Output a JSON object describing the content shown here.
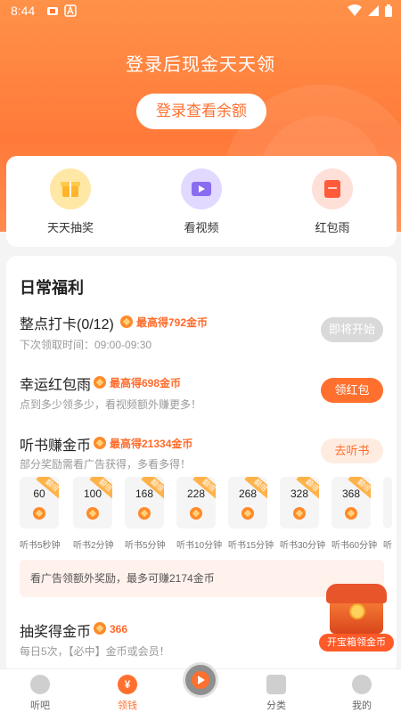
{
  "status_bar": {
    "time": "8:44"
  },
  "hero": {
    "title": "登录后现金天天领",
    "login_button": "登录查看余额"
  },
  "features": [
    {
      "label": "天天抽奖",
      "icon": "gift-icon",
      "color": "#ffe7a6"
    },
    {
      "label": "看视频",
      "icon": "tv-icon",
      "color": "#e1d9ff"
    },
    {
      "label": "红包雨",
      "icon": "red-envelope-icon",
      "color": "#ffe0d9"
    }
  ],
  "welfare": {
    "title": "日常福利",
    "tasks": [
      {
        "title": "整点打卡(0/12)",
        "reward": "最高得792金币",
        "sub": "下次领取时间：09:00-09:30",
        "button": "即将开始"
      },
      {
        "title": "幸运红包雨",
        "reward": "最高得698金币",
        "sub": "点到多少领多少，看视频额外赚更多！",
        "button": "领红包"
      },
      {
        "title": "听书赚金币",
        "reward": "最高得21334金币",
        "sub": "部分奖励需看广告获得，多看多得！",
        "button": "去听书"
      }
    ],
    "steps": [
      {
        "amount": "60",
        "label": "听书5秒钟"
      },
      {
        "amount": "100",
        "label": "听书2分钟"
      },
      {
        "amount": "168",
        "label": "听书5分钟"
      },
      {
        "amount": "228",
        "label": "听书10分钟"
      },
      {
        "amount": "268",
        "label": "听书15分钟"
      },
      {
        "amount": "328",
        "label": "听书30分钟"
      },
      {
        "amount": "368",
        "label": "听书60分钟"
      },
      {
        "amount": "",
        "label": "听"
      }
    ],
    "step_tag": "翻倍",
    "tip": "看广告领额外奖励，最多可赚2174金币",
    "lottery": {
      "title": "抽奖得金币",
      "reward": "366",
      "sub": "每日5次，【必中】金币或会员！"
    }
  },
  "chest": {
    "label": "开宝箱领金币"
  },
  "bottom_nav": {
    "items": [
      {
        "label": "听吧"
      },
      {
        "label": "领钱",
        "icon_text": "¥"
      },
      {
        "label": "分类"
      },
      {
        "label": "我的"
      }
    ]
  }
}
